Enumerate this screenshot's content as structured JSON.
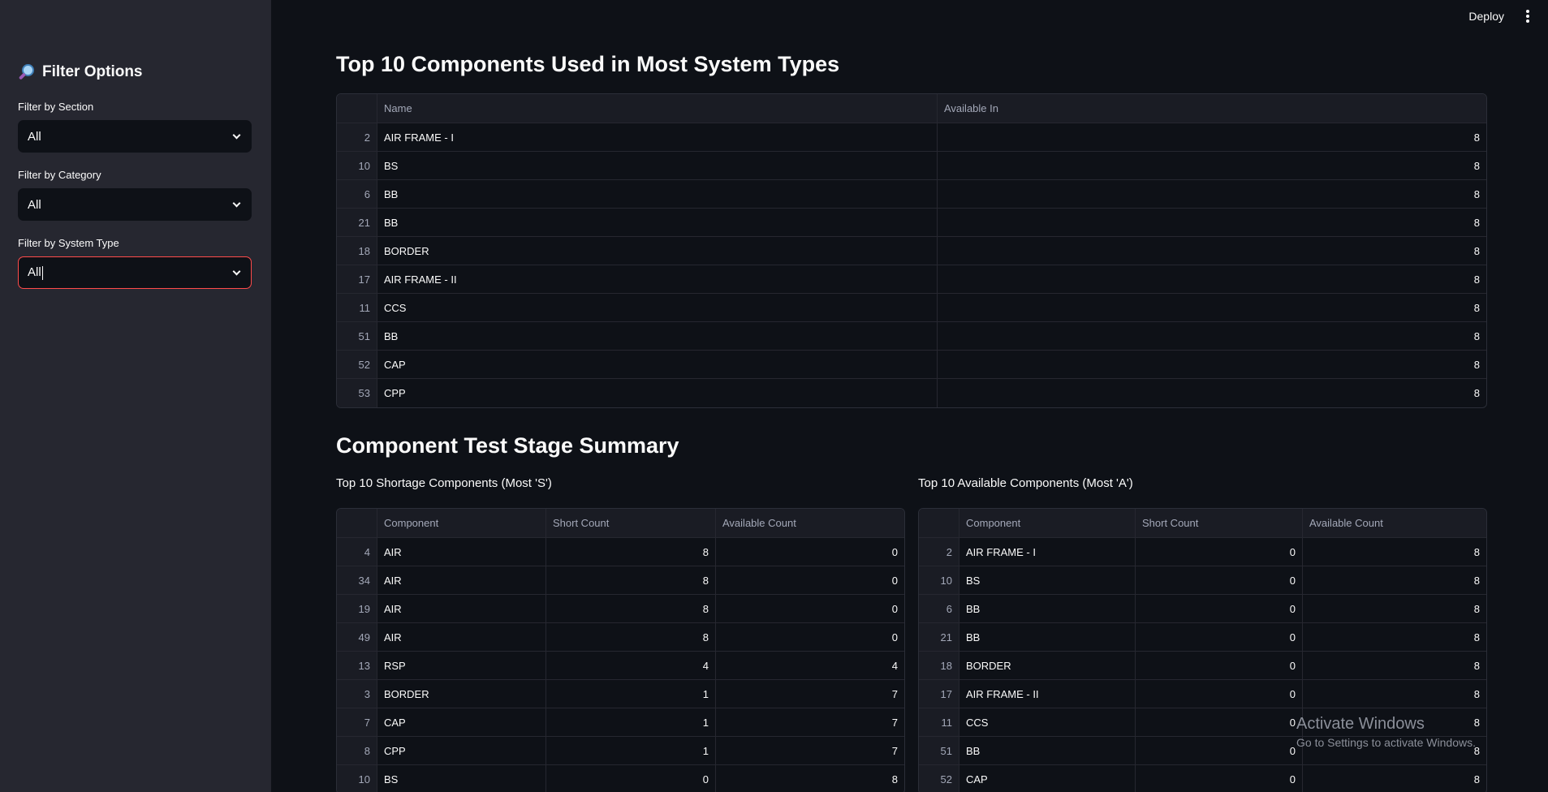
{
  "sidebar": {
    "title": "Filter Options",
    "filters": [
      {
        "label": "Filter by Section",
        "value": "All"
      },
      {
        "label": "Filter by Category",
        "value": "All"
      },
      {
        "label": "Filter by System Type",
        "value": "All"
      }
    ]
  },
  "topbar": {
    "deploy_label": "Deploy"
  },
  "colors": {
    "accent": "#ff4b4b",
    "sidebar_bg": "#262730",
    "main_bg": "#0e1117"
  },
  "top_components": {
    "title": "Top 10 Components Used in Most System Types",
    "columns": [
      "",
      "Name",
      "Available In"
    ],
    "rows": [
      [
        "2",
        "AIR FRAME - I",
        "8"
      ],
      [
        "10",
        "BS",
        "8"
      ],
      [
        "6",
        "BB",
        "8"
      ],
      [
        "21",
        "BB",
        "8"
      ],
      [
        "18",
        "BORDER",
        "8"
      ],
      [
        "17",
        "AIR FRAME - II",
        "8"
      ],
      [
        "11",
        "CCS",
        "8"
      ],
      [
        "51",
        "BB",
        "8"
      ],
      [
        "52",
        "CAP",
        "8"
      ],
      [
        "53",
        "CPP",
        "8"
      ]
    ]
  },
  "test_stage": {
    "title": "Component Test Stage Summary",
    "shortage": {
      "title": "Top 10 Shortage Components (Most 'S')",
      "columns": [
        "",
        "Component",
        "Short Count",
        "Available Count"
      ],
      "rows": [
        [
          "4",
          "AIR",
          "8",
          "0"
        ],
        [
          "34",
          "AIR",
          "8",
          "0"
        ],
        [
          "19",
          "AIR",
          "8",
          "0"
        ],
        [
          "49",
          "AIR",
          "8",
          "0"
        ],
        [
          "13",
          "RSP",
          "4",
          "4"
        ],
        [
          "3",
          "BORDER",
          "1",
          "7"
        ],
        [
          "7",
          "CAP",
          "1",
          "7"
        ],
        [
          "8",
          "CPP",
          "1",
          "7"
        ],
        [
          "10",
          "BS",
          "0",
          "8"
        ]
      ]
    },
    "available": {
      "title": "Top 10 Available Components (Most 'A')",
      "columns": [
        "",
        "Component",
        "Short Count",
        "Available Count"
      ],
      "rows": [
        [
          "2",
          "AIR FRAME - I",
          "0",
          "8"
        ],
        [
          "10",
          "BS",
          "0",
          "8"
        ],
        [
          "6",
          "BB",
          "0",
          "8"
        ],
        [
          "21",
          "BB",
          "0",
          "8"
        ],
        [
          "18",
          "BORDER",
          "0",
          "8"
        ],
        [
          "17",
          "AIR FRAME - II",
          "0",
          "8"
        ],
        [
          "11",
          "CCS",
          "0",
          "8"
        ],
        [
          "51",
          "BB",
          "0",
          "8"
        ],
        [
          "52",
          "CAP",
          "0",
          "8"
        ]
      ]
    }
  },
  "watermark": {
    "line1": "Activate Windows",
    "line2": "Go to Settings to activate Windows."
  }
}
